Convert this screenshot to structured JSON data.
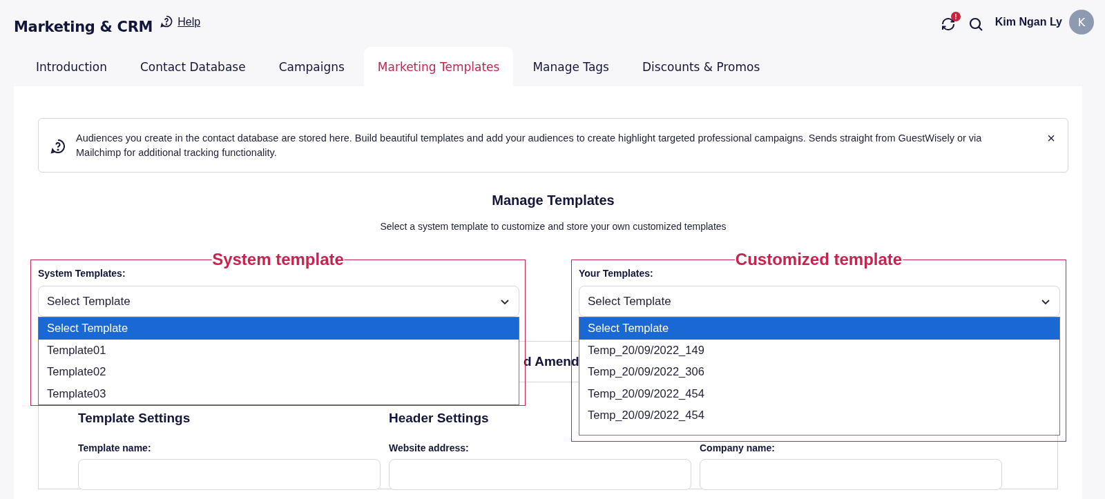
{
  "header": {
    "title": "Marketing & CRM",
    "help": "Help",
    "alert_badge": "!",
    "user_name": "Kim Ngan Ly",
    "avatar_initial": "K"
  },
  "tabs": [
    {
      "label": "Introduction",
      "selected": false
    },
    {
      "label": "Contact Database",
      "selected": false
    },
    {
      "label": "Campaigns",
      "selected": false
    },
    {
      "label": "Marketing Templates",
      "selected": true
    },
    {
      "label": "Manage Tags",
      "selected": false
    },
    {
      "label": "Discounts & Promos",
      "selected": false
    }
  ],
  "banner": {
    "text": "Audiences you create in the contact database are stored here. Build beautiful templates and add your audiences to create highlight targeted professional campaigns. Sends straight from GuestWisely or via Mailchimp for additional tracking functionality.",
    "close": "×"
  },
  "heading": "Manage Templates",
  "subtitle": "Select a system template to customize and store your own customized templates",
  "pickers": [
    {
      "annotation": "System template",
      "label": "System Templates:",
      "value": "Select Template",
      "expanded": true,
      "options": [
        {
          "label": "Select Template",
          "selected": true
        },
        {
          "label": "Template01",
          "selected": false
        },
        {
          "label": "Template02",
          "selected": false
        },
        {
          "label": "Template03",
          "selected": false
        }
      ]
    },
    {
      "annotation": "Customized template",
      "label": "Your Templates:",
      "value": "Select Template",
      "expanded": true,
      "options": [
        {
          "label": "Select Template",
          "selected": true
        },
        {
          "label": "Temp_20/09/2022_149",
          "selected": false
        },
        {
          "label": "Temp_20/09/2022_306",
          "selected": false
        },
        {
          "label": "Temp_20/09/2022_454",
          "selected": false
        },
        {
          "label": "Temp_20/09/2022_454",
          "selected": false
        }
      ]
    }
  ],
  "section": {
    "heading": "d Amend",
    "columns": [
      {
        "title": "Template Settings",
        "field_label": "Template name:"
      },
      {
        "title": "Header Settings",
        "field_label": "Website address:"
      },
      {
        "field_label": "Company name:"
      }
    ]
  }
}
